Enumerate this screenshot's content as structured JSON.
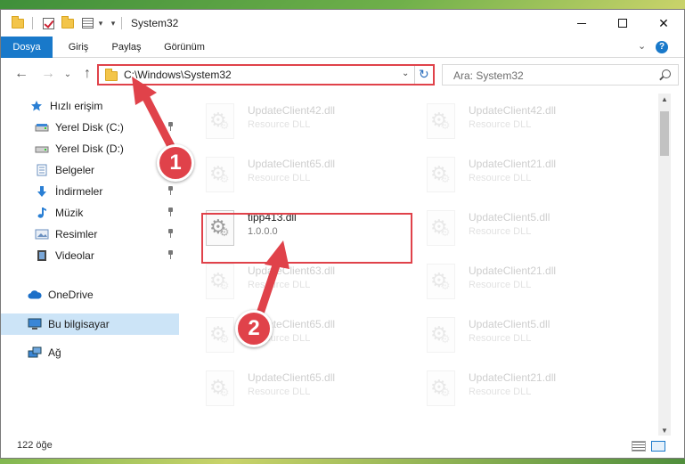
{
  "window": {
    "title": "System32",
    "controls": {
      "minimize": "minimize-icon",
      "maximize": "maximize-icon",
      "close": "✕"
    }
  },
  "ribbon": {
    "tabs": [
      "Dosya",
      "Giriş",
      "Paylaş",
      "Görünüm"
    ],
    "help": "?",
    "expand": "⌄"
  },
  "nav": {
    "back": "←",
    "forward": "→",
    "recent": "⌄",
    "up": "↑",
    "address": "C:\\Windows\\System32",
    "address_dropdown": "⌄",
    "refresh": "↻",
    "search_placeholder": "Ara: System32"
  },
  "sidebar": {
    "items": [
      {
        "label": "Hızlı erişim",
        "icon": "star-icon"
      },
      {
        "label": "Yerel Disk (C:)",
        "icon": "drive-icon",
        "pinned": true
      },
      {
        "label": "Yerel Disk (D:)",
        "icon": "drive-icon"
      },
      {
        "label": "Belgeler",
        "icon": "documents-icon"
      },
      {
        "label": "İndirmeler",
        "icon": "download-icon",
        "pinned": true
      },
      {
        "label": "Müzik",
        "icon": "music-icon",
        "pinned": true
      },
      {
        "label": "Resimler",
        "icon": "pictures-icon",
        "pinned": true
      },
      {
        "label": "Videolar",
        "icon": "video-icon",
        "pinned": true
      },
      {
        "label": "OneDrive",
        "icon": "cloud-icon"
      },
      {
        "label": "Bu bilgisayar",
        "icon": "computer-icon",
        "selected": true
      },
      {
        "label": "Ağ",
        "icon": "network-icon"
      }
    ]
  },
  "files": [
    {
      "name": "UpdateClient42.dll",
      "sub": "Resource DLL",
      "faded": true
    },
    {
      "name": "UpdateClient42.dll",
      "sub": "Resource DLL",
      "faded": true
    },
    {
      "name": "UpdateClient65.dll",
      "sub": "Resource DLL",
      "faded": true
    },
    {
      "name": "UpdateClient21.dll",
      "sub": "Resource DLL",
      "faded": true
    },
    {
      "name": "tipp413.dll",
      "sub": "1.0.0.0",
      "faded": false
    },
    {
      "name": "UpdateClient5.dll",
      "sub": "Resource DLL",
      "faded": true
    },
    {
      "name": "UpdateClient63.dll",
      "sub": "Resource DLL",
      "faded": true
    },
    {
      "name": "UpdateClient21.dll",
      "sub": "Resource DLL",
      "faded": true
    },
    {
      "name": "UpdateClient65.dll",
      "sub": "Resource DLL",
      "faded": true
    },
    {
      "name": "UpdateClient5.dll",
      "sub": "Resource DLL",
      "faded": true
    },
    {
      "name": "UpdateClient65.dll",
      "sub": "Resource DLL",
      "faded": true
    },
    {
      "name": "UpdateClient21.dll",
      "sub": "Resource DLL",
      "faded": true
    }
  ],
  "status": {
    "item_count": "122 öğe"
  },
  "callouts": [
    "1",
    "2"
  ],
  "colors": {
    "accent": "#1979ca",
    "highlight": "#e0424a",
    "selected": "#cce4f7"
  }
}
